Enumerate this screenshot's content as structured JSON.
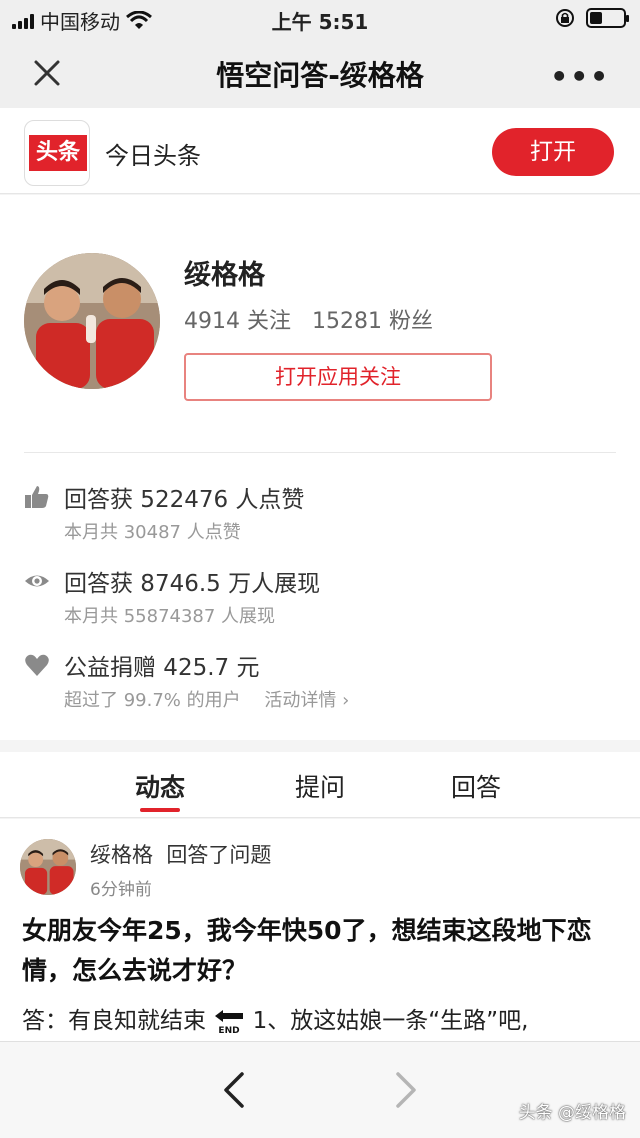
{
  "status_bar": {
    "carrier": "中国移动",
    "time": "上午 5:51"
  },
  "nav": {
    "title": "悟空问答-绥格格",
    "more_label": "•••"
  },
  "app_banner": {
    "logo_text": "头条",
    "app_name": "今日头条",
    "open_label": "打开"
  },
  "profile": {
    "name": "绥格格",
    "stats": "4914 关注   15281 粉丝",
    "follow_label": "打开应用关注"
  },
  "stats": [
    {
      "icon": "thumbs-up-icon",
      "main": "回答获 522476 人点赞",
      "sub": "本月共 30487 人点赞"
    },
    {
      "icon": "eye-icon",
      "main": "回答获 8746.5 万人展现",
      "sub": "本月共 55874387 人展现"
    },
    {
      "icon": "heart-icon",
      "main": "公益捐赠 425.7 元",
      "sub": "超过了 99.7% 的用户",
      "link": "活动详情 ›"
    }
  ],
  "tabs": [
    {
      "label": "动态",
      "active": true
    },
    {
      "label": "提问",
      "active": false
    },
    {
      "label": "回答",
      "active": false
    }
  ],
  "feed": {
    "user": "绥格格  回答了问题",
    "time": "6分钟前",
    "title": "女朋友今年25，我今年快50了，想结束这段地下恋情，怎么去说才好？",
    "answer_prefix": "答：有良知就结束",
    "answer_suffix": "1、放这姑娘一条“生路”吧,"
  },
  "watermark": "头条 @绥格格",
  "colors": {
    "brand_red": "#e1232b",
    "nav_bg": "#efefef"
  }
}
